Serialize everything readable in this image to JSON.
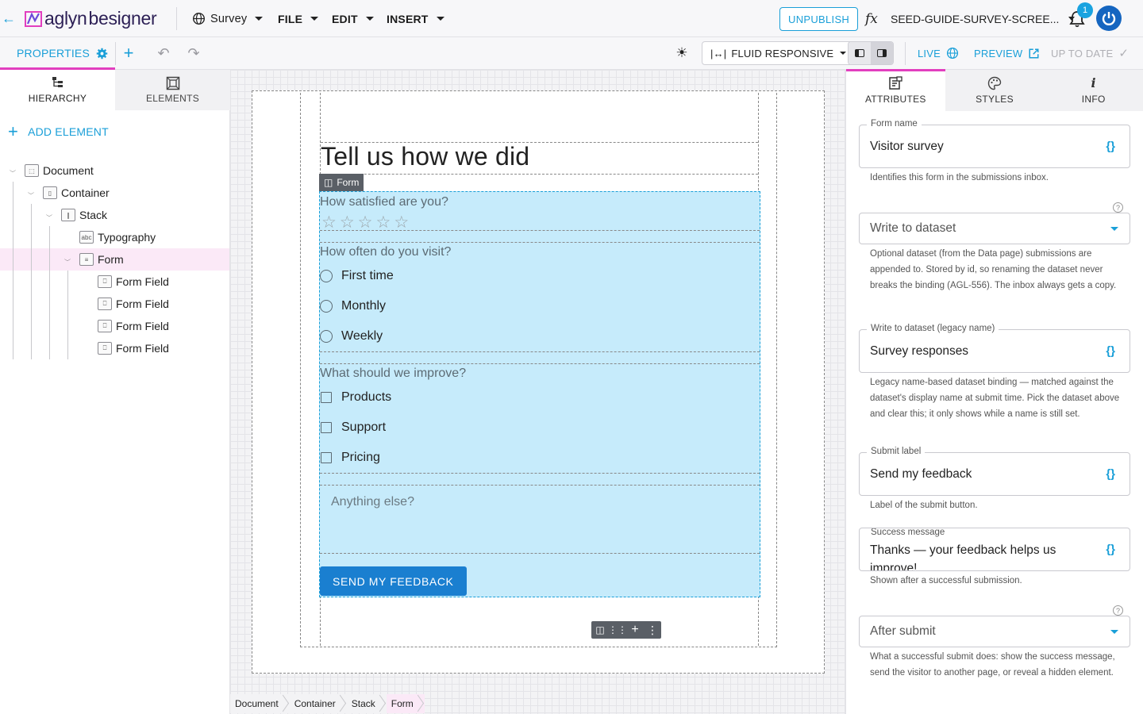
{
  "topbar": {
    "logo_part1": "aglyn",
    "logo_part2": "besigner",
    "project_menu": "Survey",
    "menus": [
      "FILE",
      "EDIT",
      "INSERT"
    ],
    "unpublish_label": "UNPUBLISH",
    "fx_label": "fx",
    "page_name": "SEED-GUIDE-SURVEY-SCREE...",
    "notification_count": "1"
  },
  "toolbar": {
    "properties_label": "PROPERTIES",
    "responsive_mode": "FLUID RESPONSIVE",
    "live_label": "LIVE",
    "preview_label": "PREVIEW",
    "status_label": "UP TO DATE"
  },
  "left_panel": {
    "tabs": [
      "HIERARCHY",
      "ELEMENTS"
    ],
    "add_element_label": "ADD ELEMENT",
    "tree": [
      {
        "label": "Document",
        "icon": "document-icon",
        "depth": 0,
        "expanded": true
      },
      {
        "label": "Container",
        "icon": "container-icon",
        "depth": 1,
        "expanded": true
      },
      {
        "label": "Stack",
        "icon": "stack-icon",
        "depth": 2,
        "expanded": true
      },
      {
        "label": "Typography",
        "icon": "typography-icon",
        "depth": 3,
        "expanded": null
      },
      {
        "label": "Form",
        "icon": "form-icon",
        "depth": 3,
        "expanded": true,
        "selected": true
      },
      {
        "label": "Form Field",
        "icon": "form-field-icon",
        "depth": 4,
        "expanded": null
      },
      {
        "label": "Form Field",
        "icon": "form-field-icon",
        "depth": 4,
        "expanded": null
      },
      {
        "label": "Form Field",
        "icon": "form-field-icon",
        "depth": 4,
        "expanded": null
      },
      {
        "label": "Form Field",
        "icon": "form-field-icon",
        "depth": 4,
        "expanded": null
      }
    ]
  },
  "canvas": {
    "heading": "Tell us how we did",
    "form_chip_label": "Form",
    "questions": {
      "satisfaction": "How satisfied are you?",
      "frequency": "How often do you visit?",
      "improve": "What should we improve?"
    },
    "star_count": 5,
    "radio_options": [
      "First time",
      "Monthly",
      "Weekly"
    ],
    "checkbox_options": [
      "Products",
      "Support",
      "Pricing"
    ],
    "textarea_placeholder": "Anything else?",
    "submit_label": "SEND MY FEEDBACK",
    "breadcrumbs": [
      "Document",
      "Container",
      "Stack",
      "Form"
    ]
  },
  "right_panel": {
    "tabs": [
      "ATTRIBUTES",
      "STYLES",
      "INFO"
    ],
    "form_name": {
      "label": "Form name",
      "value": "Visitor survey",
      "help": "Identifies this form in the submissions inbox."
    },
    "write_to_dataset": {
      "placeholder": "Write to dataset",
      "help": "Optional dataset (from the Data page) submissions are appended to. Stored by id, so renaming the dataset never breaks the binding (AGL-556). The inbox always gets a copy."
    },
    "legacy_dataset": {
      "label": "Write to dataset (legacy name)",
      "value": "Survey responses",
      "help": "Legacy name-based dataset binding — matched against the dataset's display name at submit time. Pick the dataset above and clear this; it only shows while a name is still set."
    },
    "submit_label": {
      "label": "Submit label",
      "value": "Send my feedback",
      "help": "Label of the submit button."
    },
    "success_message": {
      "label": "Success message",
      "value": "Thanks — your feedback helps us improve!",
      "help": "Shown after a successful submission."
    },
    "after_submit": {
      "placeholder": "After submit",
      "help": "What a successful submit does: show the success message, send the visitor to another page, or reveal a hidden element."
    },
    "braces_symbol": "{}",
    "help_symbol": "?"
  },
  "colors": {
    "accent": "#1a9fd8",
    "brand_pink": "#e23fbf",
    "form_selection": "#c6ebfb",
    "primary_button": "#1a7fd0"
  }
}
